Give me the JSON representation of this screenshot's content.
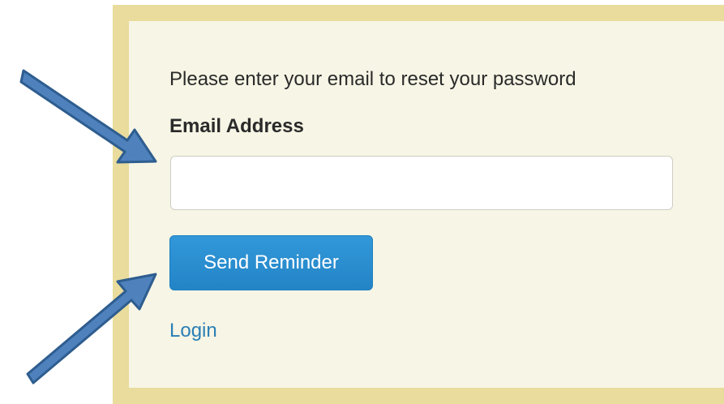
{
  "form": {
    "prompt": "Please enter your email to reset your password",
    "email_label": "Email Address",
    "email_value": "",
    "email_placeholder": "",
    "submit_label": "Send Reminder",
    "login_link": "Login"
  },
  "colors": {
    "frame": "#e9dc9c",
    "panel": "#f7f5e5",
    "button": "#2384c6",
    "link": "#2a7fb6",
    "arrow_fill": "#4f81bd",
    "arrow_stroke": "#2e5d8f"
  },
  "annotations": {
    "arrows": [
      "arrow-icon",
      "arrow-icon"
    ]
  }
}
